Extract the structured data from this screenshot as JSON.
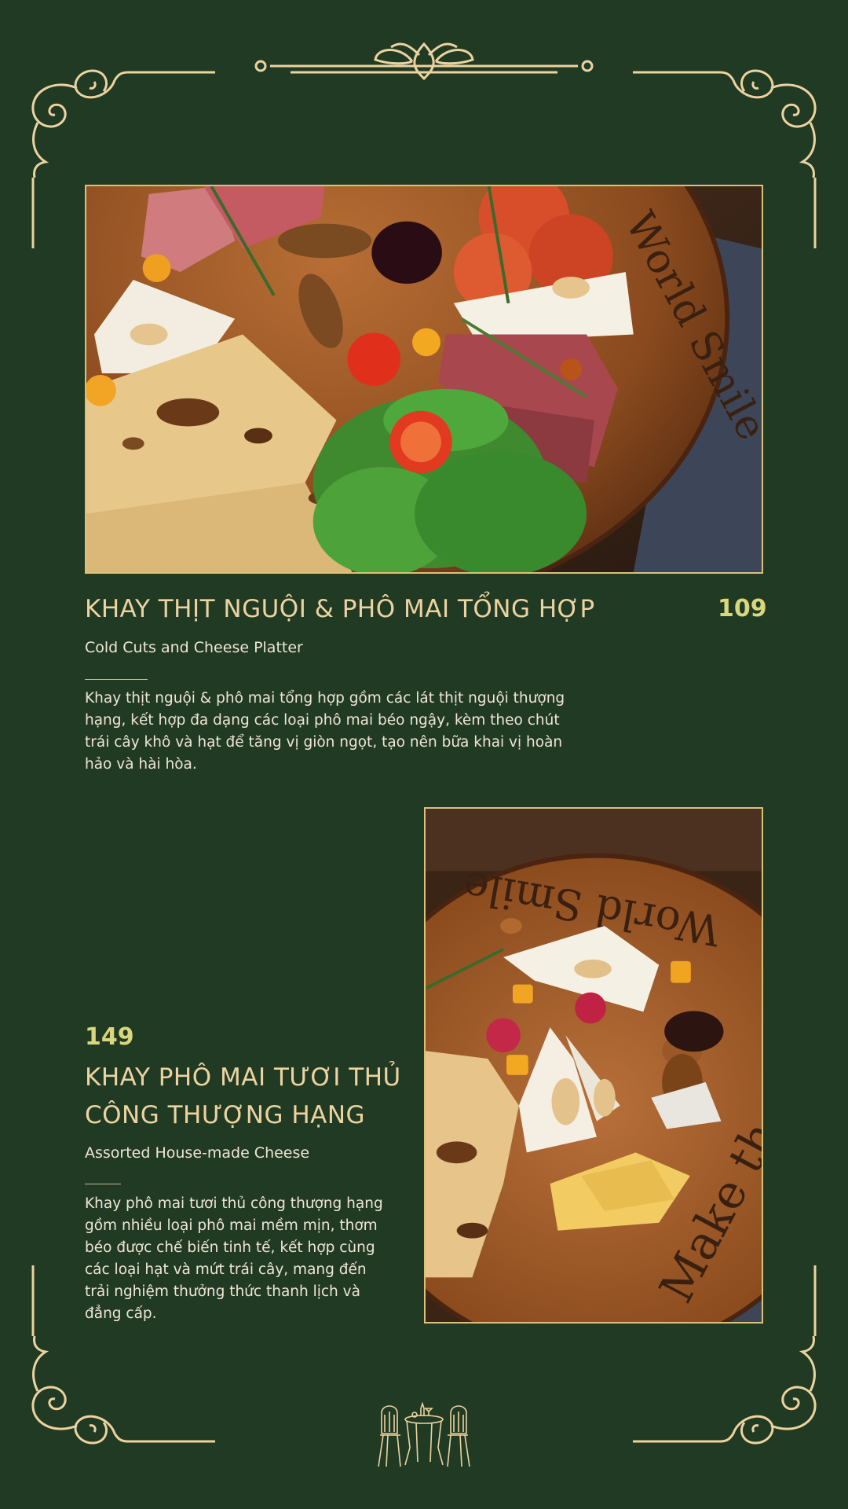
{
  "items": [
    {
      "title": "KHAY THỊT NGUỘI & PHÔ MAI TỔNG HỢP",
      "price": "109",
      "subtitle": "Cold Cuts and Cheese Platter",
      "description": "Khay thịt nguội & phô mai tổng hợp gồm các lát thịt nguội thượng hạng, kết hợp đa dạng các loại phô mai béo ngậy, kèm theo chút trái cây khô và hạt để tăng vị giòn ngọt, tạo nên bữa khai vị hoàn hảo và hài hòa."
    },
    {
      "title_line1": "KHAY PHÔ MAI TƯƠI THỦ",
      "title_line2": "CÔNG THƯỢNG HẠNG",
      "price": "149",
      "subtitle": "Assorted House-made Cheese",
      "description": "Khay phô mai tươi thủ công thượng hạng gồm nhiều loại phô mai mềm mịn, thơm béo được chế biến tinh tế, kết hợp cùng các loại hạt và mứt trái cây, mang đến trải nghiệm thưởng thức thanh lịch và đẳng cấp."
    }
  ],
  "board_engraving": {
    "top": "World Smile",
    "bottom": "Make the"
  },
  "colors": {
    "background": "#213a24",
    "gold": "#ecd3a0",
    "frame": "#d8c27a",
    "price": "#d9d77e",
    "text": "#efe6d4"
  },
  "icons": [
    "scroll-corner-ornament",
    "top-center-flourish",
    "bistro-table-icon"
  ]
}
